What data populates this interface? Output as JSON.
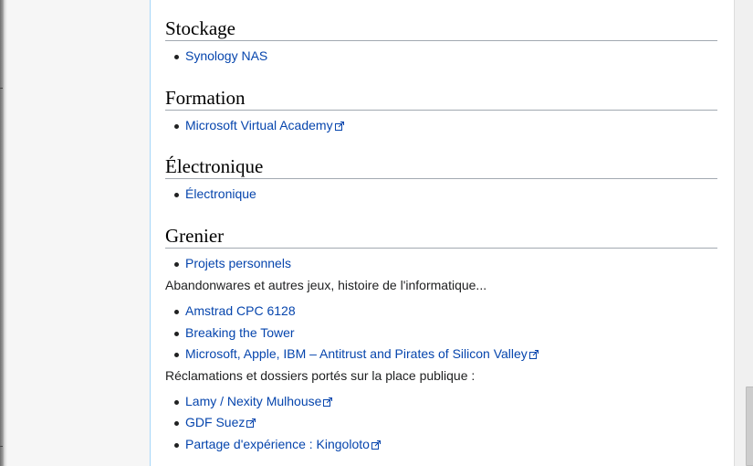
{
  "sections": [
    {
      "heading": "Stockage",
      "items": [
        {
          "label": "Synology NAS",
          "external": false
        }
      ]
    },
    {
      "heading": "Formation",
      "items": [
        {
          "label": "Microsoft Virtual Academy",
          "external": true
        }
      ]
    },
    {
      "heading": "Électronique",
      "items": [
        {
          "label": "Électronique",
          "external": false
        }
      ]
    },
    {
      "heading": "Grenier",
      "items": [
        {
          "label": "Projets personnels",
          "external": false
        }
      ],
      "para1": "Abandonwares et autres jeux, histoire de l'informatique...",
      "items2": [
        {
          "label": "Amstrad CPC 6128",
          "external": false
        },
        {
          "label": "Breaking the Tower",
          "external": false
        },
        {
          "label": "Microsoft, Apple, IBM – Antitrust and Pirates of Silicon Valley",
          "external": true
        }
      ],
      "para2": "Réclamations et dossiers portés sur la place publique :",
      "items3": [
        {
          "label": "Lamy / Nexity Mulhouse",
          "external": true
        },
        {
          "label": "GDF Suez",
          "external": true
        },
        {
          "label": "Partage d'expérience : Kingoloto",
          "external": true
        }
      ]
    }
  ],
  "colors": {
    "link": "#0645ad",
    "text": "#202122",
    "rule": "#a2a9b1",
    "content_border": "#a7d7f9"
  },
  "icons": {
    "external_link": "external-link-icon"
  }
}
